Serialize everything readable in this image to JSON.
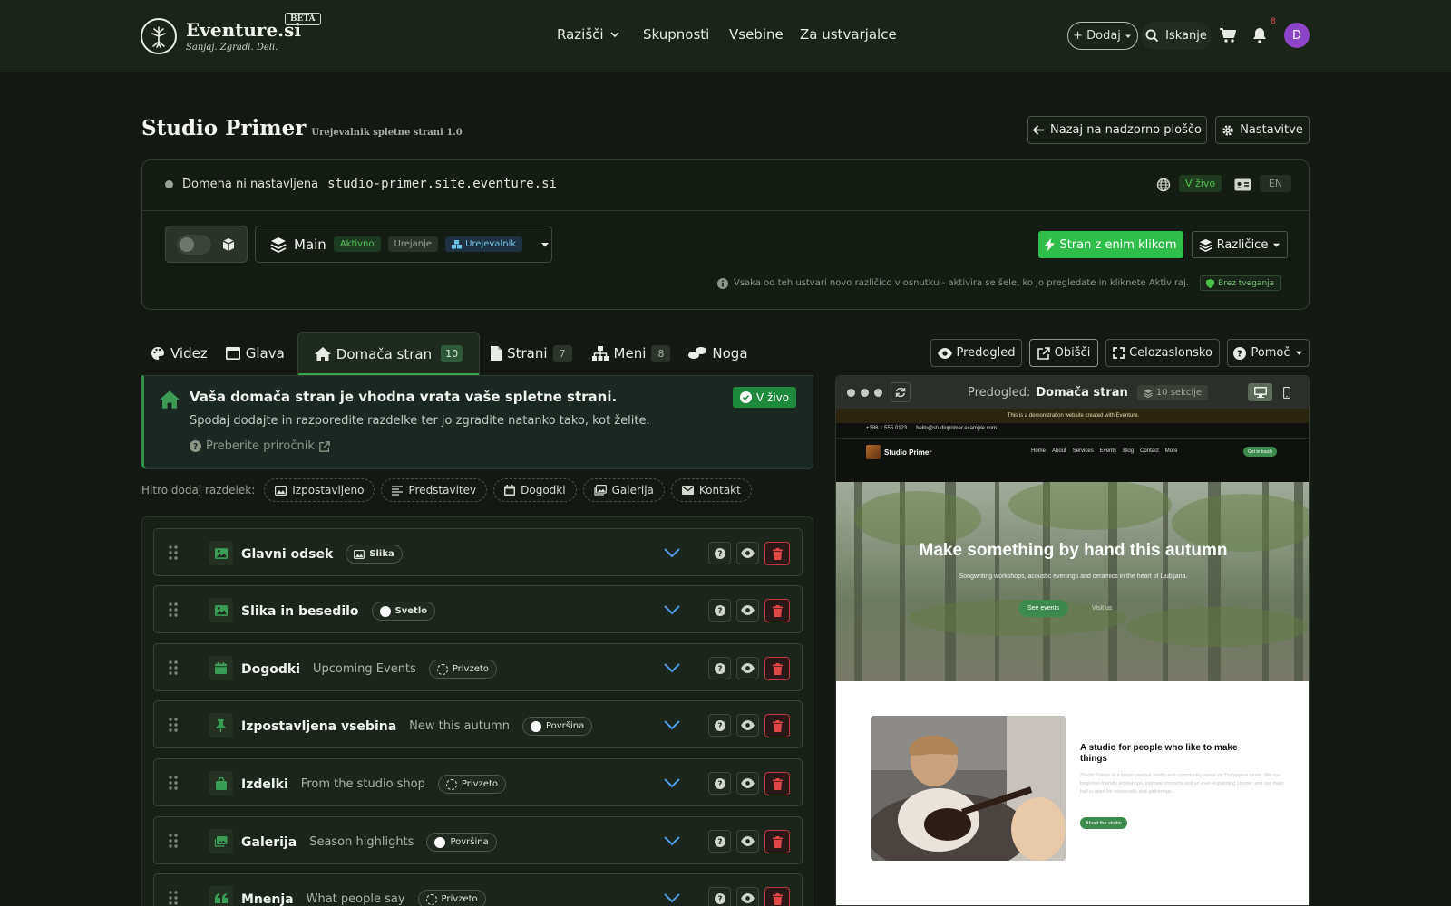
{
  "topnav": {
    "brand": "Eventure.si",
    "tagline": "Sanjaj. Zgradi. Deli.",
    "beta": "BETA",
    "menu": [
      "Razišči",
      "Skupnosti",
      "Vsebine",
      "Za ustvarjalce"
    ],
    "add_label": "+ Dodaj",
    "search_label": "Iskanje",
    "notif_count": "8",
    "avatar_initial": "D"
  },
  "header": {
    "title": "Studio Primer",
    "subtitle": "Urejevalnik spletne strani 1.0",
    "back_label": "Nazaj na nadzorno ploščo",
    "settings_label": "Nastavitve"
  },
  "domain": {
    "status_text": "Domena ni nastavljena",
    "host": "studio-primer.site.eventure.si",
    "live_label": "V živo",
    "lang": "EN"
  },
  "version": {
    "name": "Main",
    "chips": [
      "Aktivno",
      "Urejanje",
      "Urejevalnik"
    ],
    "one_click_label": "Stran z enim klikom",
    "versions_label": "Različice",
    "info": "Vsaka od teh ustvari novo različico v osnutku - aktivira se šele, ko jo pregledate in kliknete Aktiviraj.",
    "safe_label": "Brez tveganja"
  },
  "tabs": [
    {
      "label": "Videz",
      "count": ""
    },
    {
      "label": "Glava",
      "count": ""
    },
    {
      "label": "Domača stran",
      "count": "10"
    },
    {
      "label": "Strani",
      "count": "7"
    },
    {
      "label": "Meni",
      "count": "8"
    },
    {
      "label": "Noga",
      "count": ""
    }
  ],
  "toolbar": {
    "preview_label": "Predogled",
    "visit_label": "Obišči",
    "fullscreen_label": "Celozaslonsko",
    "help_label": "Pomoč"
  },
  "home_info": {
    "title": "Vaša domača stran je vhodna vrata vaše spletne strani.",
    "text": "Spodaj dodajte in razporedite razdelke ter jo zgradite natanko tako, kot želite.",
    "guide_label": "Preberite priročnik",
    "live_label": "V živo"
  },
  "quick_add": {
    "label": "Hitro dodaj razdelek:",
    "items": [
      "Izpostavljeno",
      "Predstavitev",
      "Dogodki",
      "Galerija",
      "Kontakt"
    ]
  },
  "sections": [
    {
      "name": "Glavni odsek",
      "desc": "",
      "pill": "Slika"
    },
    {
      "name": "Slika in besedilo",
      "desc": "",
      "pill": "Svetlo"
    },
    {
      "name": "Dogodki",
      "desc": "Upcoming Events",
      "pill": "Privzeto"
    },
    {
      "name": "Izpostavljena vsebina",
      "desc": "New this autumn",
      "pill": "Površina"
    },
    {
      "name": "Izdelki",
      "desc": "From the studio shop",
      "pill": "Privzeto"
    },
    {
      "name": "Galerija",
      "desc": "Season highlights",
      "pill": "Površina"
    },
    {
      "name": "Mnenja",
      "desc": "What people say",
      "pill": "Privzeto"
    }
  ],
  "preview": {
    "label": "Predogled:",
    "page": "Domača stran",
    "sections": "10 sekcije",
    "site": {
      "banner": "This is a demonstration website created with Eventure.",
      "phone": "+386 1 555 0123",
      "email": "hello@studioprimer.example.com",
      "name": "Studio Primer",
      "nav": [
        "Home",
        "About",
        "Services",
        "Events",
        "Blog",
        "Contact",
        "More"
      ],
      "cta": "Get in touch",
      "hero_title": "Make something by hand this autumn",
      "hero_sub": "Songwriting workshops, acoustic evenings and ceramics in the heart of Ljubljana.",
      "hero_btn": "See events",
      "hero_btn2": "Visit us",
      "about_title": "A studio for people who like to make things",
      "about_text": "Studio Primer is a small creative studio and community venue on Trubarjeva cesta. We run beginner-friendly workshops, intimate concerts and an ever-expanding course, and our main hall is open for rehearsals and gatherings.",
      "about_btn": "About the studio"
    }
  }
}
